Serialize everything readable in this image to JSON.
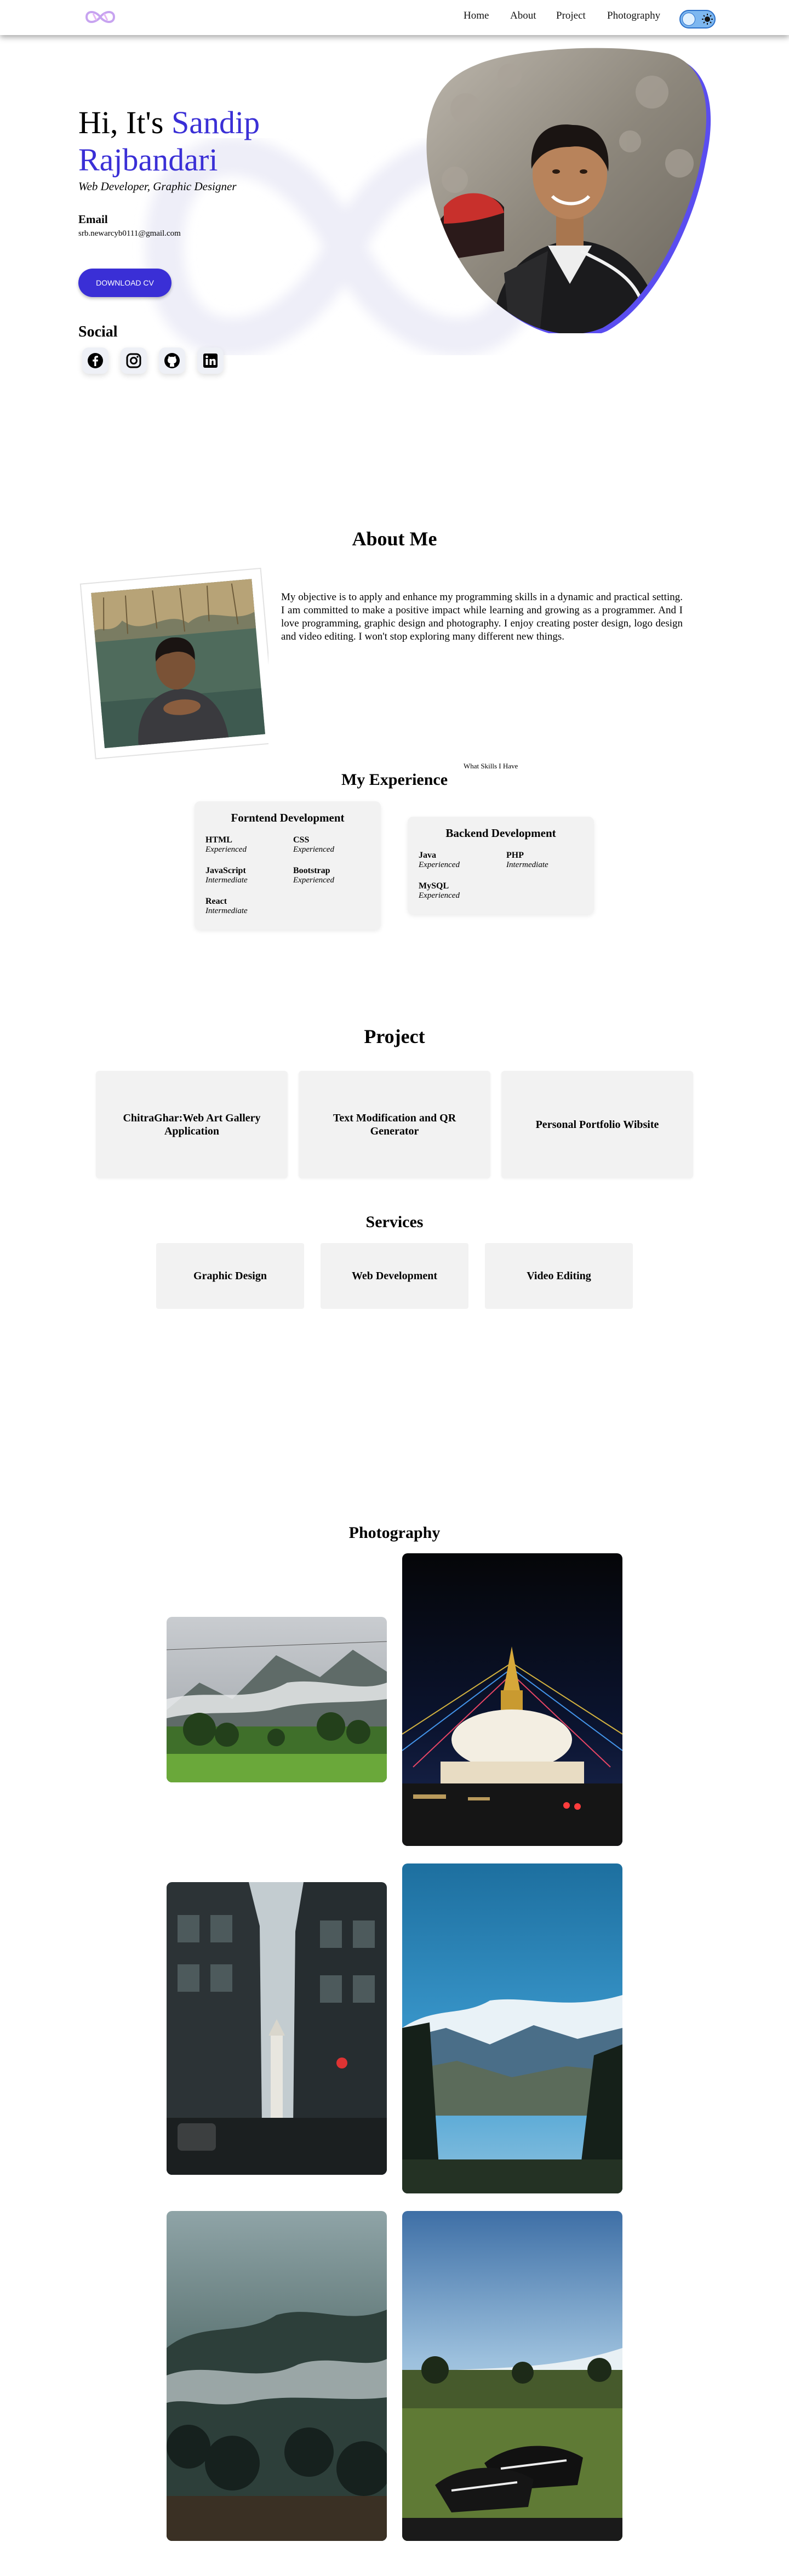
{
  "nav": {
    "links": [
      "Home",
      "About",
      "Project",
      "Photography"
    ],
    "theme_toggle_icon": "sun-icon"
  },
  "hero": {
    "greeting": "Hi, It's ",
    "name": "Sandip Rajbandari",
    "subtitle": "Web Developer, Graphic Designer",
    "email_label": "Email",
    "email_value": "srb.newarcyb0111@gmail.com",
    "cv_button": "DOWNLOAD CV",
    "social_label": "Social",
    "social_icons": [
      "facebook-icon",
      "instagram-icon",
      "github-icon",
      "linkedin-icon"
    ]
  },
  "about": {
    "title": "About Me",
    "text": "My objective is to apply and enhance my programming skills in a dynamic and practical setting. I am committed to make a positive impact while learning and growing as a programmer. And I love programming, graphic design and photography. I enjoy creating poster design, logo design and video editing. I won't stop exploring many different new things."
  },
  "experience": {
    "caption": "What Skills I Have",
    "title": "My Experience",
    "frontend": {
      "title": "Forntend Development",
      "skills": [
        {
          "name": "HTML",
          "level": "Experienced"
        },
        {
          "name": "CSS",
          "level": "Experienced"
        },
        {
          "name": "JavaScript",
          "level": "Intermediate"
        },
        {
          "name": "Bootstrap",
          "level": "Experienced"
        },
        {
          "name": "React",
          "level": "Intermediate"
        }
      ]
    },
    "backend": {
      "title": "Backend Development",
      "skills": [
        {
          "name": "Java",
          "level": "Experienced"
        },
        {
          "name": "PHP",
          "level": "Intermediate"
        },
        {
          "name": "MySQL",
          "level": "Experienced"
        }
      ]
    }
  },
  "projects": {
    "title": "Project",
    "items": [
      "ChitraGhar:Web Art Gallery Application",
      "Text Modification and QR Generator",
      "Personal Portfolio Wibsite"
    ]
  },
  "services": {
    "title": "Services",
    "items": [
      "Graphic Design",
      "Web Development",
      "Video Editing"
    ]
  },
  "photography": {
    "title": "Photography"
  },
  "colors": {
    "accent": "#3a2fd6",
    "card": "#f2f2f2"
  }
}
